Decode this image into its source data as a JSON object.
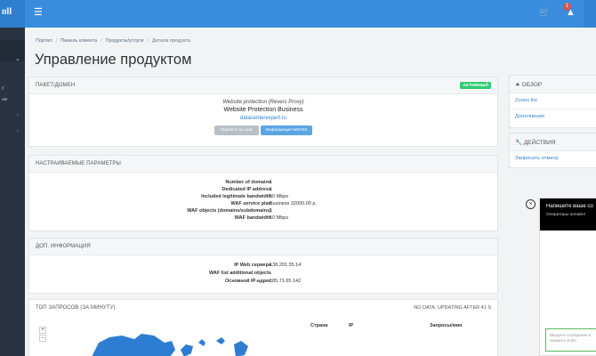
{
  "header": {
    "brand": "ııll",
    "menu_icon": "menu-icon",
    "cart_icon": "cart-icon",
    "bell_icon": "bell-icon",
    "notification_count": "1",
    "accent_color": "#3a8dde"
  },
  "sidebar": {
    "items": [
      {
        "label": "у"
      },
      {
        "label": "ам"
      }
    ]
  },
  "breadcrumb": {
    "items": [
      "Портал",
      "Панель клиента",
      "Продукты/услуги"
    ],
    "current": "Детали продукта"
  },
  "page_title": "Управление продуктом",
  "package_panel": {
    "title": "ПАКЕТ/ДОМЕН",
    "status": "АКТИВНЫЙ",
    "status_color": "#2ecc71",
    "subtitle": "Website protection (Revers Proxy)",
    "product_name": "Website Protection Business",
    "domain": "datacenterexpert.ru",
    "btn_goto": "Перейти на сайт",
    "btn_whois": "Информация WHOIS"
  },
  "config_panel": {
    "title": "НАСТРАИВАЕМЫЕ ПАРАМЕТРЫ",
    "rows": [
      {
        "label": "Number of domains",
        "value": "1"
      },
      {
        "label": "Dedicated IP address",
        "value": "1"
      },
      {
        "label": "Included legitimate bandwidth",
        "value": "50 Mbps"
      },
      {
        "label": "WAF service plan",
        "value": "Business 32000.00 р."
      },
      {
        "label": "WAF objects (domains/subdomains)",
        "value": "1"
      },
      {
        "label": "WAF bandwidth",
        "value": "10 Mbps"
      }
    ]
  },
  "extra_panel": {
    "title": "ДОП. ИНФОРМАЦИЯ",
    "rows": [
      {
        "label": "IP Web сервера",
        "value": "138.201.35.14"
      },
      {
        "label": "WAF list additional objects",
        "value": ""
      },
      {
        "label": "Основной IP-адрес",
        "value": "185.71.65.142"
      }
    ]
  },
  "top_panel": {
    "title": "ТОП ЗАПРОСОВ (ЗА МИНУТУ)",
    "status": "NO DATA, UPDATING AFTER 41 S",
    "zoom_in": "+",
    "zoom_out": "−",
    "columns": [
      "Страна",
      "IP",
      "Запросы/мин"
    ]
  },
  "overview": {
    "title": "ОБЗОР",
    "icon": "star-icon",
    "links": [
      "Zones list",
      "Дополнения"
    ]
  },
  "actions": {
    "title": "ДЕЙСТВИЯ",
    "icon": "wrench-icon",
    "links": [
      "Запросить отмену"
    ]
  },
  "chat": {
    "title": "Напишите ваше со",
    "subtitle": "Операторы онлайн!",
    "placeholder": "Введите сообщение и нажмите Enter"
  }
}
